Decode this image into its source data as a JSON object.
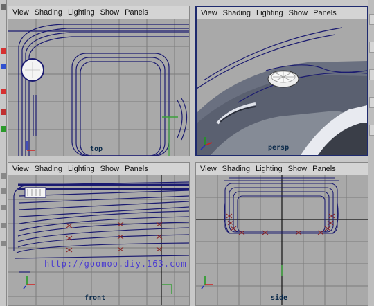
{
  "menu": [
    "View",
    "Shading",
    "Lighting",
    "Show",
    "Panels"
  ],
  "panels": {
    "top": {
      "label": "top"
    },
    "persp": {
      "label": "persp"
    },
    "front": {
      "label": "front"
    },
    "side": {
      "label": "side"
    }
  },
  "watermark": "http://goomoo.diy.163.com",
  "axes": {
    "x": "x",
    "y": "y",
    "z": "z"
  },
  "colors": {
    "viewport_bg": "#a9a9a9",
    "grid": "#7c7c7c",
    "wire": "#1b1b70",
    "active_border": "#1e2a6e",
    "axis_x": "#d02020",
    "axis_y": "#1a9a1a",
    "axis_z": "#2030c0"
  },
  "icons": [
    "move-tool-icon",
    "rotate-tool-icon",
    "scale-tool-icon",
    "select-tool-icon"
  ]
}
